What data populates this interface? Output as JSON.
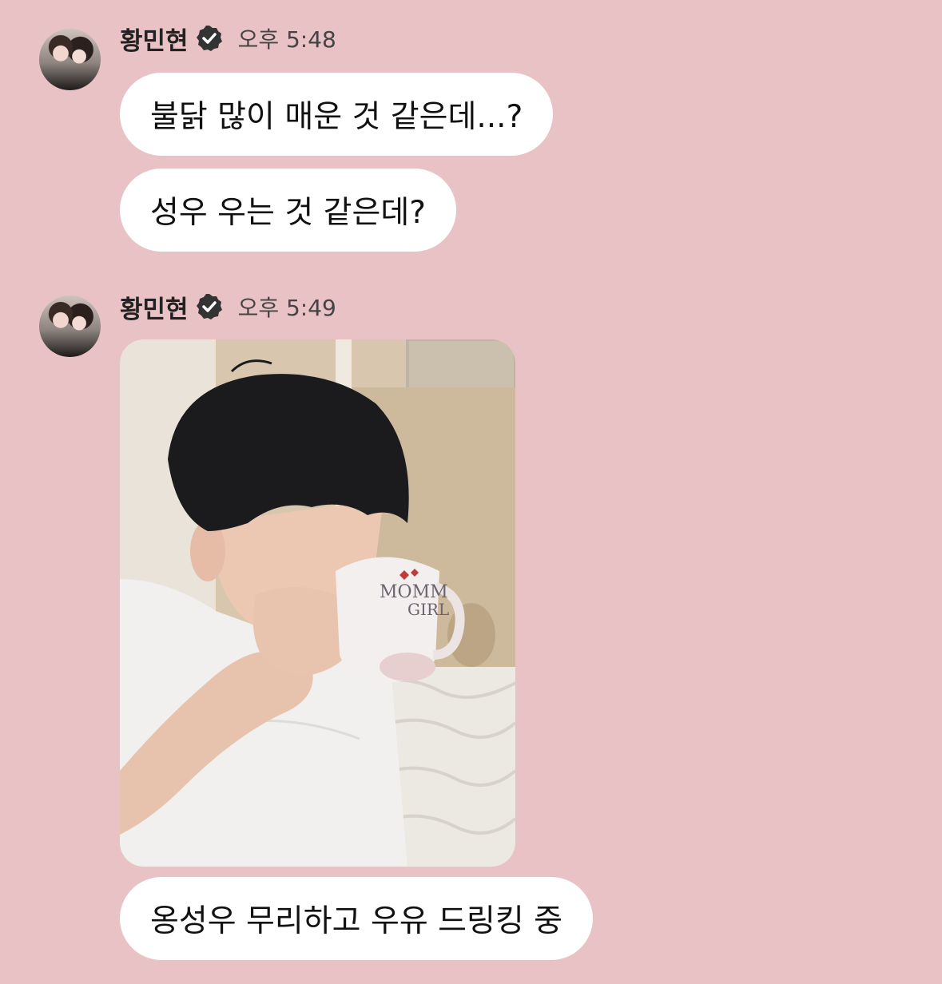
{
  "messages": [
    {
      "sender": "황민현",
      "time": "오후 5:48",
      "bubbles": [
        "불닭 많이 매운 것 같은데...?",
        "성우 우는 것 같은데?"
      ]
    },
    {
      "sender": "황민현",
      "time": "오후 5:49",
      "photo": {
        "mug_text_line1": "MOMM",
        "mug_text_line2": "GIRL"
      },
      "bubbles": [
        "옹성우 무리하고 우유 드링킹 중"
      ]
    }
  ],
  "colors": {
    "background": "#e8c2c5",
    "bubble": "#ffffff",
    "verified_badge": "#333333"
  }
}
